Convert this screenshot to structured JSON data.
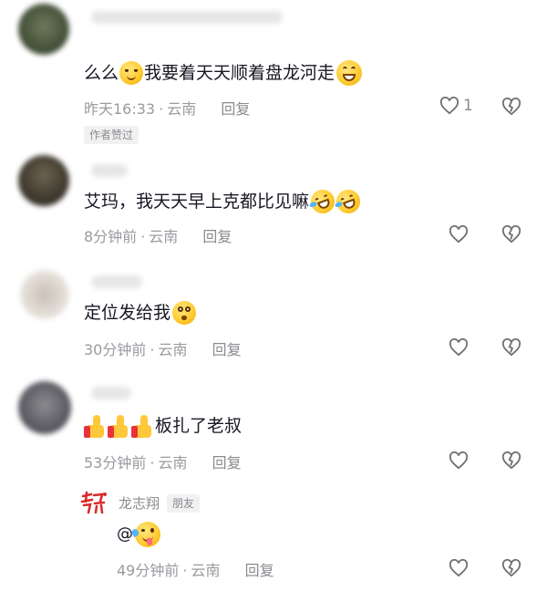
{
  "comments": [
    {
      "text_prefix": "么么",
      "text_mid": "我要着天天顺着盘龙河走",
      "time": "昨天16:33",
      "location": "云南",
      "reply_label": "回复",
      "like_count": "1",
      "badge": "作者赞过"
    },
    {
      "text": "艾玛，我天天早上克都比见嘛",
      "time": "8分钟前",
      "location": "云南",
      "reply_label": "回复"
    },
    {
      "text": "定位发给我",
      "time": "30分钟前",
      "location": "云南",
      "reply_label": "回复"
    },
    {
      "text": "板扎了老叔",
      "time": "53分钟前",
      "location": "云南",
      "reply_label": "回复"
    }
  ],
  "reply": {
    "user_name": "龙志翔",
    "tag": "朋友",
    "text": "@",
    "time": "49分钟前",
    "location": "云南",
    "reply_label": "回复"
  },
  "separator": "·",
  "icons": {
    "like": "heart-outline-icon",
    "dislike": "broken-heart-icon",
    "emoji_smile": "smiling-face-emoji",
    "emoji_grin": "grinning-face-emoji",
    "emoji_laugh_cry": "rolling-laughing-emoji",
    "emoji_shock": "astonished-face-emoji",
    "emoji_thumb": "thumbs-up-emoji",
    "emoji_wink": "winking-tongue-emoji",
    "avatar_logo": "red-calligraphy-logo"
  },
  "colors": {
    "text": "#161823",
    "meta": "#9a9aa0",
    "badge_bg": "#f1f1f2",
    "emoji": "#ffcc33",
    "logo_red": "#d92b2b"
  }
}
